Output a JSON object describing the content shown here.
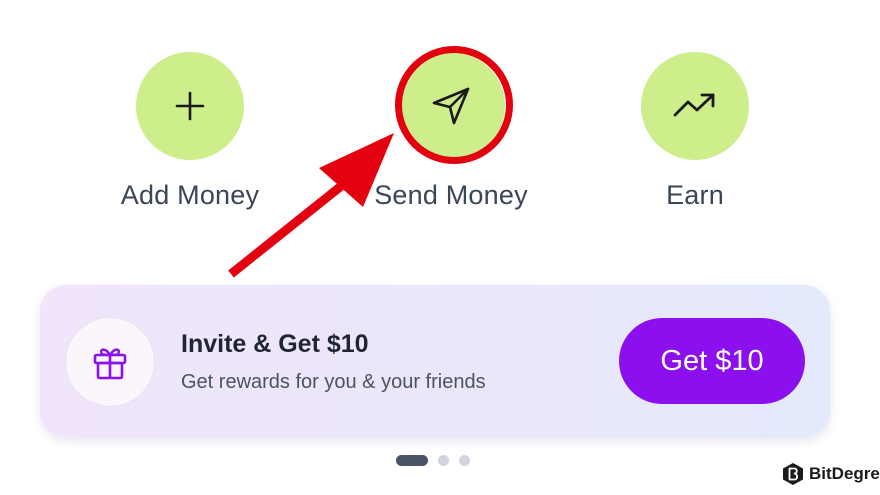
{
  "actions": [
    {
      "label": "Add Money",
      "icon": "plus-icon"
    },
    {
      "label": "Send Money",
      "icon": "paper-plane-icon"
    },
    {
      "label": "Earn",
      "icon": "trending-up-icon"
    }
  ],
  "promo": {
    "title": "Invite & Get $10",
    "subtitle": "Get rewards for you & your friends",
    "button_label": "Get $10",
    "icon": "gift-icon"
  },
  "pagination": {
    "pages": 3,
    "active": 1
  },
  "watermark": {
    "text": "BitDegree",
    "logo": "bitdegree-logo"
  },
  "colors": {
    "action_circle": "#cdee8a",
    "highlight": "#e3000f",
    "button": "#8c10ee",
    "gift_icon": "#8c10ee"
  }
}
